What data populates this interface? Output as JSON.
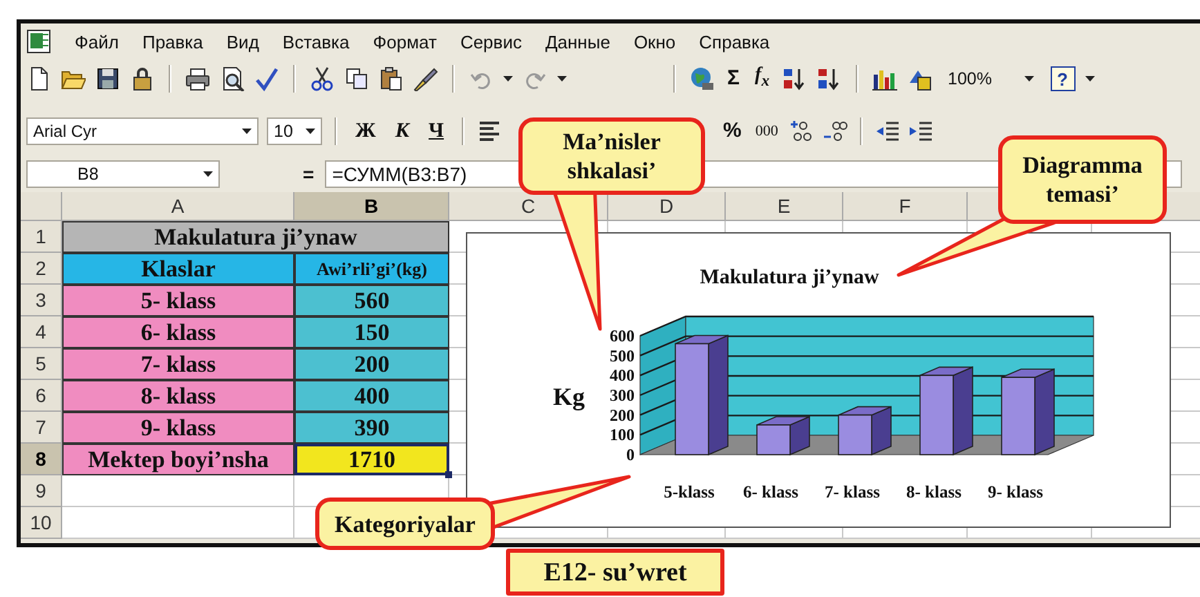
{
  "window": {
    "menu": [
      "Файл",
      "Правка",
      "Вид",
      "Вставка",
      "Формат",
      "Сервис",
      "Данные",
      "Окно",
      "Справка"
    ]
  },
  "standard_toolbar": {
    "sum": "Σ",
    "function": "f$_{x}$",
    "zoom": "100%",
    "help": "?"
  },
  "formatting_toolbar": {
    "font": "Arial Cyr",
    "size": "10",
    "styles": [
      {
        "label": "Ж",
        "kind": "bold"
      },
      {
        "label": "К",
        "kind": "italic"
      },
      {
        "label": "Ч",
        "kind": "underline"
      }
    ],
    "percent": "%",
    "thousands": "000"
  },
  "formula_bar": {
    "name_box": "B8",
    "equals": "=",
    "formula": "=СУММ(B3:B7)"
  },
  "sheet": {
    "columns": [
      "A",
      "B",
      "C",
      "D",
      "E",
      "F"
    ],
    "rows": [
      {
        "header": "1",
        "cells": [
          {
            "text": "Makulatura ji’ynaw",
            "kind": "title",
            "selected": false
          }
        ]
      },
      {
        "header": "2",
        "cells": [
          {
            "text": "Klaslar",
            "kind": "header",
            "selected": false
          },
          {
            "text": "Awi’rli’gi’(kg)",
            "kind": "header",
            "selected": false
          }
        ]
      },
      {
        "header": "3",
        "cells": [
          {
            "text": "5- klass",
            "kind": "label",
            "selected": false
          },
          {
            "text": "560",
            "kind": "value",
            "selected": false
          }
        ]
      },
      {
        "header": "4",
        "cells": [
          {
            "text": "6- klass",
            "kind": "label",
            "selected": false
          },
          {
            "text": "150",
            "kind": "value",
            "selected": false
          }
        ]
      },
      {
        "header": "5",
        "cells": [
          {
            "text": "7- klass",
            "kind": "label",
            "selected": false
          },
          {
            "text": "200",
            "kind": "value",
            "selected": false
          }
        ]
      },
      {
        "header": "6",
        "cells": [
          {
            "text": "8- klass",
            "kind": "label",
            "selected": false
          },
          {
            "text": "400",
            "kind": "value",
            "selected": false
          }
        ]
      },
      {
        "header": "7",
        "cells": [
          {
            "text": "9- klass",
            "kind": "label",
            "selected": false
          },
          {
            "text": "390",
            "kind": "value",
            "selected": false
          }
        ]
      },
      {
        "header": "8",
        "cells": [
          {
            "text": "Mektep boyi’nsha",
            "kind": "label",
            "selected": false
          },
          {
            "text": "1710",
            "kind": "total",
            "selected": true
          }
        ]
      },
      {
        "header": "9",
        "cells": []
      },
      {
        "header": "10",
        "cells": []
      }
    ]
  },
  "chart": {
    "chart_data": {
      "type": "bar",
      "title": "Makulatura ji’ynaw",
      "ylabel": "Kg",
      "categories": [
        "5-klass",
        "6- klass",
        "7- klass",
        "8- klass",
        "9- klass"
      ],
      "values": [
        560,
        150,
        200,
        400,
        390
      ],
      "ylim": [
        0,
        600
      ],
      "yticks": [
        0,
        100,
        200,
        300,
        400,
        500,
        600
      ]
    }
  },
  "callouts": [
    {
      "text": "Ma’nisler shkalasi’"
    },
    {
      "text": "Diagramma temasi’"
    },
    {
      "text": "Kategoriyalar"
    }
  ],
  "caption": "E12- su’wret"
}
